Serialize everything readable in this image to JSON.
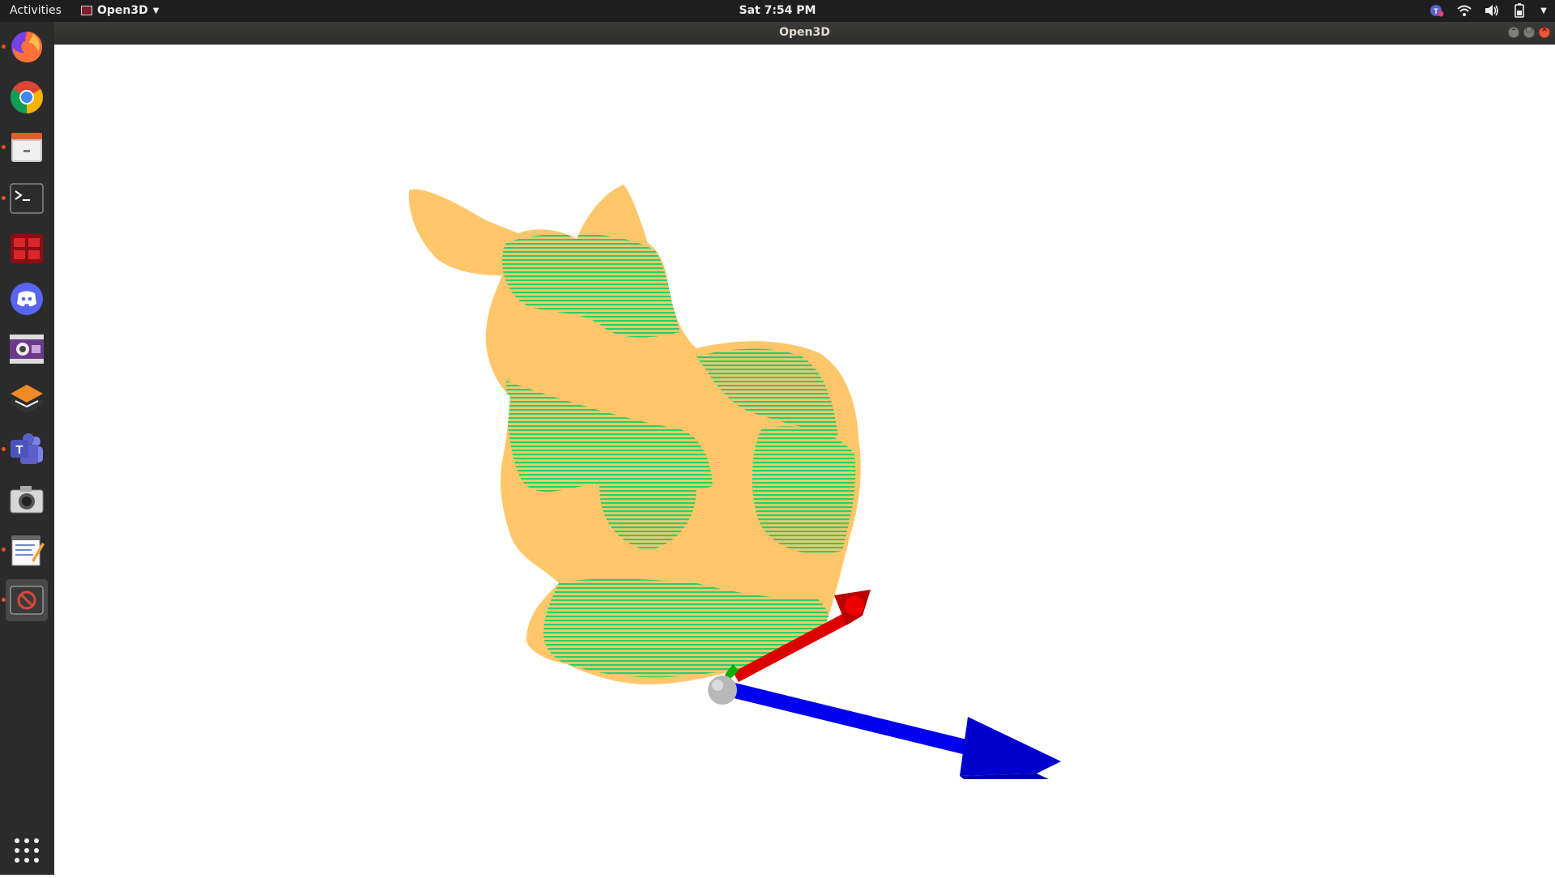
{
  "topbar": {
    "activities_label": "Activities",
    "app_menu_label": "Open3D",
    "clock": "Sat  7:54 PM"
  },
  "window": {
    "title": "Open3D"
  },
  "dock": {
    "items": [
      {
        "name": "firefox",
        "running": true
      },
      {
        "name": "chrome",
        "running": false
      },
      {
        "name": "files",
        "running": true
      },
      {
        "name": "terminal",
        "running": true
      },
      {
        "name": "red-app",
        "running": false
      },
      {
        "name": "discord",
        "running": false
      },
      {
        "name": "video-recorder",
        "running": false
      },
      {
        "name": "layers-app",
        "running": false
      },
      {
        "name": "teams",
        "running": true
      },
      {
        "name": "camera",
        "running": false
      },
      {
        "name": "text-editor",
        "running": true
      },
      {
        "name": "open3d",
        "running": true,
        "active": true
      }
    ]
  },
  "scene": {
    "colors": {
      "cloud_a": "#ffc76a",
      "cloud_b": "#23d16b",
      "axis_x": "#e00000",
      "axis_y": "#00b000",
      "axis_z": "#0000ee",
      "origin": "#b8b8b8"
    }
  }
}
